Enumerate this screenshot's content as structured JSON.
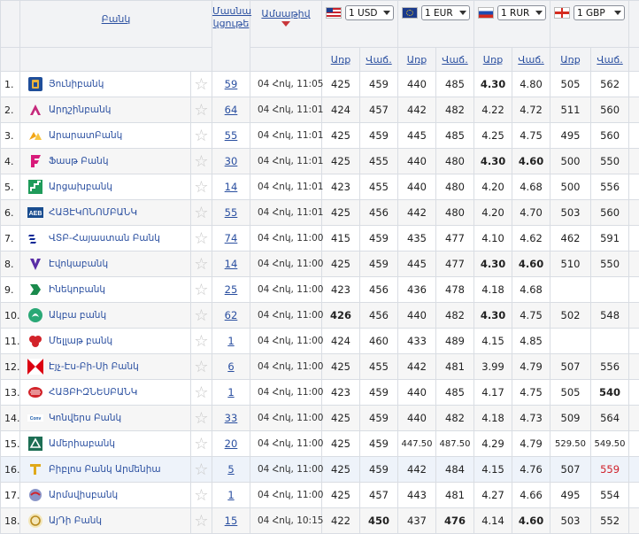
{
  "header": {
    "bank": "Բանկ",
    "participation": "Մասնա կցութե",
    "date": "Ամսաթիվ",
    "currencies": [
      {
        "code": "USD",
        "select": "1 USD"
      },
      {
        "code": "EUR",
        "select": "1 EUR"
      },
      {
        "code": "RUR",
        "select": "1 RUR"
      },
      {
        "code": "GBP",
        "select": "1 GBP"
      }
    ],
    "buy": "Առք",
    "sell": "Վաճ."
  },
  "rows": [
    {
      "n": "1.",
      "bank": "Յունիբանկ",
      "logo": "unibank",
      "part": "59",
      "date": "04 Հոկ, 11:05",
      "v": [
        "425",
        "459",
        "440",
        "485",
        "4.30",
        "4.80",
        "505",
        "562"
      ],
      "bold": [
        4
      ]
    },
    {
      "n": "2.",
      "bank": "Արդշինբանկ",
      "logo": "ardshin",
      "part": "64",
      "date": "04 Հոկ, 11:01",
      "v": [
        "424",
        "457",
        "442",
        "482",
        "4.22",
        "4.72",
        "511",
        "560"
      ],
      "bold": []
    },
    {
      "n": "3.",
      "bank": "ԱրարատԲանկ",
      "logo": "ararat",
      "part": "55",
      "date": "04 Հոկ, 11:01",
      "v": [
        "425",
        "459",
        "445",
        "485",
        "4.25",
        "4.75",
        "495",
        "560"
      ],
      "bold": []
    },
    {
      "n": "4.",
      "bank": "Ֆասթ Բանկ",
      "logo": "fast",
      "part": "30",
      "date": "04 Հոկ, 11:01",
      "v": [
        "425",
        "455",
        "440",
        "480",
        "4.30",
        "4.60",
        "500",
        "550"
      ],
      "bold": [
        4,
        5
      ]
    },
    {
      "n": "5.",
      "bank": "Արցախբանկ",
      "logo": "artsakh",
      "part": "14",
      "date": "04 Հոկ, 11:01",
      "v": [
        "423",
        "455",
        "440",
        "480",
        "4.20",
        "4.68",
        "500",
        "556"
      ],
      "bold": []
    },
    {
      "n": "6.",
      "bank": "ՀԱՅԷԿՈՆՈՄԲԱՆԿ",
      "logo": "aeb",
      "part": "55",
      "date": "04 Հոկ, 11:01",
      "v": [
        "425",
        "456",
        "442",
        "480",
        "4.20",
        "4.70",
        "503",
        "560"
      ],
      "bold": []
    },
    {
      "n": "7.",
      "bank": "ՎՏԲ-Հայաստան Բանկ",
      "logo": "vtb",
      "part": "74",
      "date": "04 Հոկ, 11:00",
      "v": [
        "415",
        "459",
        "435",
        "477",
        "4.10",
        "4.62",
        "462",
        "591"
      ],
      "bold": []
    },
    {
      "n": "8.",
      "bank": "Էվոկաբանկ",
      "logo": "evoca",
      "part": "14",
      "date": "04 Հոկ, 11:00",
      "v": [
        "425",
        "459",
        "445",
        "477",
        "4.30",
        "4.60",
        "510",
        "550"
      ],
      "bold": [
        4,
        5
      ]
    },
    {
      "n": "9.",
      "bank": "Ինեկոբանկ",
      "logo": "ineco",
      "part": "25",
      "date": "04 Հոկ, 11:00",
      "v": [
        "423",
        "456",
        "436",
        "478",
        "4.18",
        "4.68",
        "",
        ""
      ],
      "bold": []
    },
    {
      "n": "10.",
      "bank": "Ակբա բանկ",
      "logo": "acba",
      "part": "62",
      "date": "04 Հոկ, 11:00",
      "v": [
        "426",
        "456",
        "440",
        "482",
        "4.30",
        "4.75",
        "502",
        "548"
      ],
      "bold": [
        0,
        4
      ]
    },
    {
      "n": "11.",
      "bank": "Մելլաթ բանկ",
      "logo": "mellat",
      "part": "1",
      "date": "04 Հոկ, 11:00",
      "v": [
        "424",
        "460",
        "433",
        "489",
        "4.15",
        "4.85",
        "",
        ""
      ],
      "bold": []
    },
    {
      "n": "12.",
      "bank": "Էյչ-Էս-Բի-Սի Բանկ",
      "logo": "hsbc",
      "part": "6",
      "date": "04 Հոկ, 11:00",
      "v": [
        "425",
        "455",
        "442",
        "481",
        "3.99",
        "4.79",
        "507",
        "556"
      ],
      "bold": []
    },
    {
      "n": "13.",
      "bank": "ՀԱՅԲԻԶՆԵՍԲԱՆԿ",
      "logo": "abb",
      "part": "1",
      "date": "04 Հոկ, 11:00",
      "v": [
        "423",
        "459",
        "440",
        "485",
        "4.17",
        "4.75",
        "505",
        "540"
      ],
      "bold": [
        7
      ]
    },
    {
      "n": "14.",
      "bank": "Կոնվերս Բանկ",
      "logo": "converse",
      "part": "33",
      "date": "04 Հոկ, 11:00",
      "v": [
        "425",
        "459",
        "440",
        "482",
        "4.18",
        "4.73",
        "509",
        "564"
      ],
      "bold": []
    },
    {
      "n": "15.",
      "bank": "Ամերիաբանկ",
      "logo": "ameria",
      "part": "20",
      "date": "04 Հոկ, 11:00",
      "v": [
        "425",
        "459",
        "447.50",
        "487.50",
        "4.29",
        "4.79",
        "529.50",
        "549.50"
      ],
      "bold": []
    },
    {
      "n": "16.",
      "bank": "Բիբլոս Բանկ Արմենիա",
      "logo": "byblos",
      "part": "5",
      "date": "04 Հոկ, 11:00",
      "v": [
        "425",
        "459",
        "442",
        "484",
        "4.15",
        "4.76",
        "507",
        "559"
      ],
      "bold": [],
      "red": [
        7
      ],
      "hl": true
    },
    {
      "n": "17.",
      "bank": "Արմսվիսբանկ",
      "logo": "armswiss",
      "part": "1",
      "date": "04 Հոկ, 11:00",
      "v": [
        "425",
        "457",
        "443",
        "481",
        "4.27",
        "4.66",
        "495",
        "554"
      ],
      "bold": []
    },
    {
      "n": "18.",
      "bank": "ԱյԴի Բանկ",
      "logo": "idbank",
      "part": "15",
      "date": "04 Հոկ, 10:15",
      "v": [
        "422",
        "450",
        "437",
        "476",
        "4.14",
        "4.60",
        "503",
        "552"
      ],
      "bold": [
        1,
        3,
        5
      ]
    }
  ]
}
